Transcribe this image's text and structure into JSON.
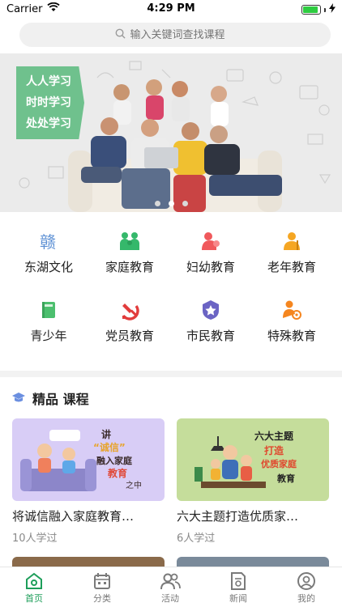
{
  "status_bar": {
    "carrier": "Carrier",
    "time": "4:29 PM",
    "battery_level": 0.9
  },
  "search": {
    "placeholder": "输入关键词查找课程"
  },
  "banner": {
    "slogan_lines": [
      "人人学习",
      "时时学习",
      "处处学习"
    ],
    "page_count": 3,
    "active_page": 1
  },
  "categories": [
    {
      "label": "东湖文化",
      "icon": "calligraphy-icon",
      "color": "#5b8fd4"
    },
    {
      "label": "家庭教育",
      "icon": "family-icon",
      "color": "#35b86b"
    },
    {
      "label": "妇幼教育",
      "icon": "mother-child-icon",
      "color": "#f0595c"
    },
    {
      "label": "老年教育",
      "icon": "elder-icon",
      "color": "#f5a623"
    },
    {
      "label": "青少年",
      "icon": "book-icon",
      "color": "#4cbf6e"
    },
    {
      "label": "党员教育",
      "icon": "party-emblem-icon",
      "color": "#e23c3c"
    },
    {
      "label": "市民教育",
      "icon": "citizen-badge-icon",
      "color": "#6b64c4"
    },
    {
      "label": "特殊教育",
      "icon": "special-care-icon",
      "color": "#f5861f"
    }
  ],
  "section": {
    "title": "精品 课程",
    "icon": "graduation-cap-icon"
  },
  "courses": [
    {
      "title": "将诚信融入家庭教育…",
      "learners": "10人学过",
      "img_color": "#d8cdf6",
      "art_words": [
        "讲",
        "“诚信”",
        "融入家庭",
        "教育",
        "之中"
      ]
    },
    {
      "title": "六大主题打造优质家…",
      "learners": "6人学过",
      "img_color": "#c5dd9b",
      "art_words": [
        "六大主题",
        "打造",
        "优质家庭",
        "教育"
      ]
    }
  ],
  "tabbar": [
    {
      "label": "首页",
      "icon": "home-icon",
      "active": true
    },
    {
      "label": "分类",
      "icon": "calendar-grid-icon",
      "active": false
    },
    {
      "label": "活动",
      "icon": "people-icon",
      "active": false
    },
    {
      "label": "新闻",
      "icon": "news-doc-icon",
      "active": false
    },
    {
      "label": "我的",
      "icon": "user-circle-icon",
      "active": false
    }
  ],
  "colors": {
    "accent": "#1e9e5a",
    "slogan_bg": "#6fc18d"
  }
}
